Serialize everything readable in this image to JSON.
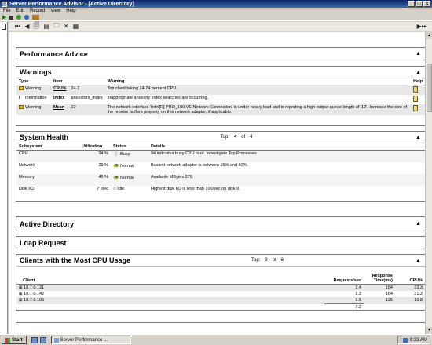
{
  "window": {
    "title": "Server Performance Advisor - [Active Directory]"
  },
  "menu": [
    "File",
    "Edit",
    "Record",
    "View",
    "Help"
  ],
  "performance_advice": {
    "title": "Performance Advice"
  },
  "warnings": {
    "title": "Warnings",
    "headers": {
      "type": "Type",
      "item": "Item",
      "value": "",
      "warning": "Warning",
      "help": "Help"
    },
    "rows": [
      {
        "type": "Warning",
        "item": "CPU%",
        "value": "24.7",
        "text": "Top client taking 24.74 percent CPU."
      },
      {
        "type": "Information",
        "item": "Index",
        "value": "ancestors_index",
        "text": "Inappropriate ancestry index searches are occurring."
      },
      {
        "type": "Warning",
        "item": "Mean",
        "value": "12",
        "text": "The network interface 'Intel[R] PRO_100 VE Network Connection' is under heavy load and is reporting a high output queue length of '12'. Increase the size of the receive buffers property on this network adapter, if applicable."
      }
    ]
  },
  "system_health": {
    "title": "System Health",
    "top_label": "Top:",
    "top_value": "4",
    "of_label": "of",
    "of_value": "4",
    "headers": {
      "subsystem": "Subsystem",
      "utilization": "Utilization",
      "status": "Status",
      "details": "Details"
    },
    "rows": [
      {
        "subsystem": "CPU",
        "utilization": "94 %",
        "status": "Busy",
        "details": "94 indicates busy CPU load. Investigate Top Processes"
      },
      {
        "subsystem": "Network",
        "utilization": "29 %",
        "status": "Normal",
        "details": "Busiest network adapter is between 15% and 60%."
      },
      {
        "subsystem": "Memory",
        "utilization": "45 %",
        "status": "Normal",
        "details": "Available MBytes 279."
      },
      {
        "subsystem": "Disk I/O",
        "utilization": "7 /sec",
        "status": "Idle",
        "details": "Highest disk I/O is less than 100/sec on disk 0."
      }
    ]
  },
  "active_directory": {
    "title": "Active Directory"
  },
  "ldap_request": {
    "title": "Ldap Request"
  },
  "clients_cpu": {
    "title": "Clients with the Most CPU Usage",
    "top_label": "Top:",
    "top_value": "3",
    "of_label": "of",
    "of_value": "6",
    "headers": {
      "client": "Client",
      "requests": "Requests/sec",
      "response": "Response Time(ms)",
      "cpu": "CPU%"
    },
    "rows": [
      {
        "client": "10.7.0.131",
        "requests": "2.4",
        "response": "164",
        "cpu": "32.3"
      },
      {
        "client": "10.7.0.142",
        "requests": "2.3",
        "response": "164",
        "cpu": "31.2"
      },
      {
        "client": "10.7.0.105",
        "requests": "1.5",
        "response": "125",
        "cpu": "10.8"
      }
    ],
    "total_requests": "7.2"
  },
  "taskbar": {
    "start": "Start",
    "task": "Server Performance ...",
    "clock": "9:33 AM"
  }
}
